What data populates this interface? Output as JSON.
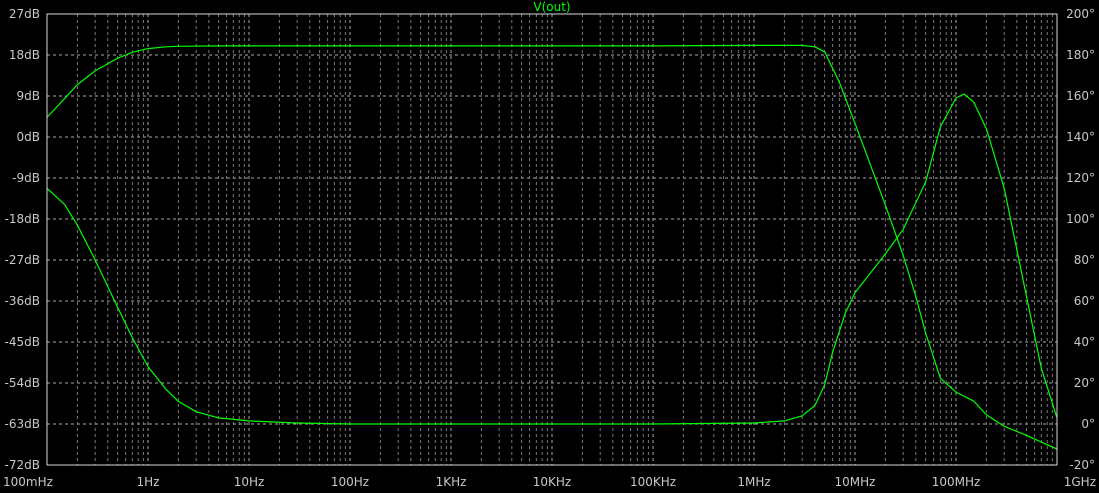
{
  "chart_data": {
    "type": "line",
    "title": "V(out)",
    "x_scale": "log",
    "xlim": [
      0.1,
      1000000000
    ],
    "x_ticks": [
      {
        "value": 0.1,
        "label": "100mHz"
      },
      {
        "value": 1,
        "label": "1Hz"
      },
      {
        "value": 10,
        "label": "10Hz"
      },
      {
        "value": 100,
        "label": "100Hz"
      },
      {
        "value": 1000,
        "label": "1KHz"
      },
      {
        "value": 10000,
        "label": "10KHz"
      },
      {
        "value": 100000,
        "label": "100KHz"
      },
      {
        "value": 1000000,
        "label": "1MHz"
      },
      {
        "value": 10000000,
        "label": "10MHz"
      },
      {
        "value": 100000000,
        "label": "100MHz"
      },
      {
        "value": 1000000000,
        "label": "1GHz"
      }
    ],
    "y_left": {
      "unit": "dB",
      "lim": [
        -72,
        27
      ],
      "ticks": [
        {
          "value": 27,
          "label": "27dB"
        },
        {
          "value": 18,
          "label": "18dB"
        },
        {
          "value": 9,
          "label": "9dB"
        },
        {
          "value": 0,
          "label": "0dB"
        },
        {
          "value": -9,
          "label": "-9dB"
        },
        {
          "value": -18,
          "label": "-18dB"
        },
        {
          "value": -27,
          "label": "-27dB"
        },
        {
          "value": -36,
          "label": "-36dB"
        },
        {
          "value": -45,
          "label": "-45dB"
        },
        {
          "value": -54,
          "label": "-54dB"
        },
        {
          "value": -63,
          "label": "-63dB"
        },
        {
          "value": -72,
          "label": "-72dB"
        }
      ]
    },
    "y_right": {
      "unit": "deg",
      "lim": [
        -20,
        200
      ],
      "ticks": [
        {
          "value": 200,
          "label": "200°"
        },
        {
          "value": 180,
          "label": "180°"
        },
        {
          "value": 160,
          "label": "160°"
        },
        {
          "value": 140,
          "label": "140°"
        },
        {
          "value": 120,
          "label": "120°"
        },
        {
          "value": 100,
          "label": "100°"
        },
        {
          "value": 80,
          "label": "80°"
        },
        {
          "value": 60,
          "label": "60°"
        },
        {
          "value": 40,
          "label": "40°"
        },
        {
          "value": 20,
          "label": "20°"
        },
        {
          "value": 0,
          "label": "0°"
        },
        {
          "value": -20,
          "label": "-20°"
        }
      ]
    },
    "grid": true,
    "series": [
      {
        "axis": "left",
        "color": "#00ff00",
        "x": [
          0.1,
          0.15,
          0.2,
          0.3,
          0.5,
          0.7,
          1,
          1.5,
          2,
          5,
          10,
          100,
          1000,
          10000,
          100000,
          1000000,
          2000000,
          3000000,
          4000000,
          5000000,
          7000000,
          10000000,
          20000000,
          30000000,
          40000000,
          50000000,
          70000000,
          100000000,
          150000000,
          200000000,
          300000000,
          500000000,
          1000000000
        ],
        "values": [
          4.3,
          8.5,
          11.5,
          14.5,
          17.3,
          18.6,
          19.4,
          19.8,
          19.9,
          20,
          20,
          20,
          20,
          20,
          20,
          20.1,
          20.1,
          20.1,
          19.8,
          18.7,
          12,
          3,
          -15,
          -26,
          -35,
          -43,
          -53,
          -56,
          -58,
          -61,
          -63.5,
          -65.5,
          -68.5
        ]
      },
      {
        "axis": "right",
        "color": "#00ff00",
        "x": [
          0.1,
          0.15,
          0.2,
          0.3,
          0.5,
          0.7,
          1,
          1.5,
          2,
          3,
          5,
          10,
          30,
          100,
          1000,
          100000,
          1000000,
          2000000,
          3000000,
          4000000,
          5000000,
          6000000,
          8000000,
          10000000,
          20000000,
          30000000,
          50000000,
          70000000,
          100000000,
          120000000,
          150000000,
          200000000,
          300000000,
          500000000,
          700000000,
          1000000000
        ],
        "values": [
          115,
          107,
          97,
          80,
          57,
          42,
          28,
          17,
          11,
          6,
          3,
          1.5,
          0.5,
          0,
          0,
          0,
          0.5,
          1.5,
          4,
          9,
          19,
          35,
          54,
          64,
          83,
          95,
          118,
          145,
          159,
          161,
          157,
          144,
          115,
          62,
          27,
          3
        ]
      }
    ]
  }
}
